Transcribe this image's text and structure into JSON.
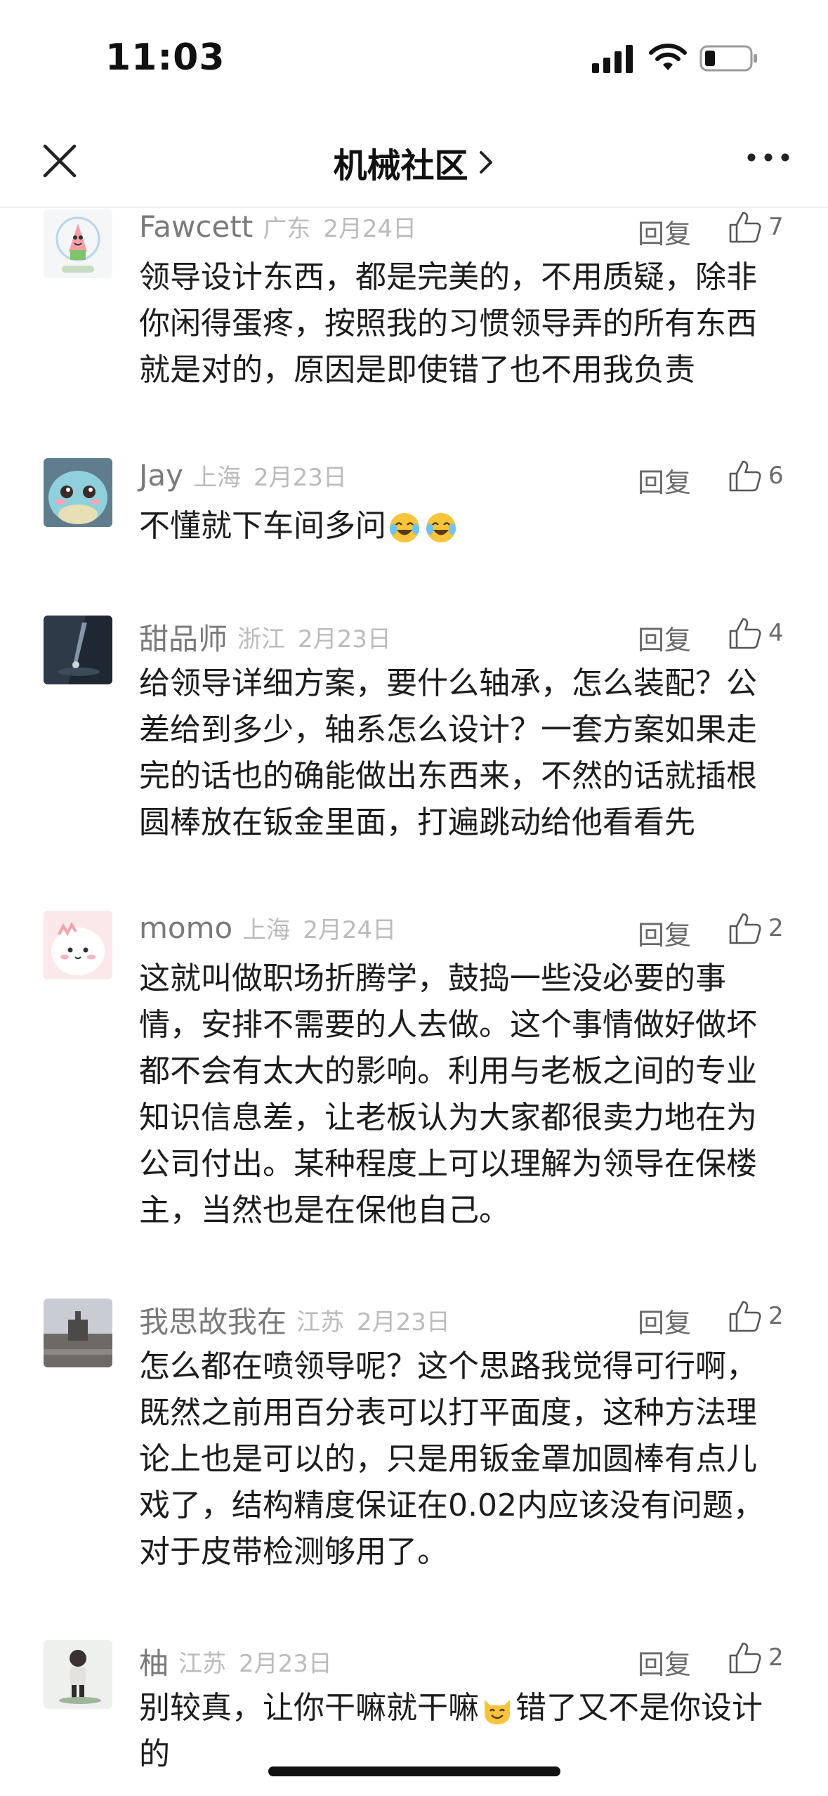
{
  "status_bar": {
    "time": "11:03"
  },
  "nav": {
    "title": "机械社区"
  },
  "reply_label": "回复",
  "comments": [
    {
      "username": "Fawcett",
      "location": "广东",
      "date": "2月24日",
      "likes": "7",
      "parts": [
        "领导设计东西，都是完美的，不用质疑，除非你闲得蛋疼，按照我的习惯领导弄的所有东西就是对的，原因是即使错了也不用我负责"
      ]
    },
    {
      "username": "Jay",
      "location": "上海",
      "date": "2月23日",
      "likes": "6",
      "parts": [
        "不懂就下车间多问"
      ]
    },
    {
      "username": "甜品师",
      "location": "浙江",
      "date": "2月23日",
      "likes": "4",
      "parts": [
        "给领导详细方案，要什么轴承，怎么装配？公差给到多少，轴系怎么设计？一套方案如果走完的话也的确能做出东西来，不然的话就插根圆棒放在钣金里面，打遍跳动给他看看先"
      ]
    },
    {
      "username": "momo",
      "location": "上海",
      "date": "2月24日",
      "likes": "2",
      "parts": [
        "这就叫做职场折腾学，鼓捣一些没必要的事情，安排不需要的人去做。这个事情做好做坏都不会有太大的影响。利用与老板之间的专业知识信息差，让老板认为大家都很卖力地在为公司付出。某种程度上可以理解为领导在保楼主，当然也是在保他自己。"
      ]
    },
    {
      "username": "我思故我在",
      "location": "江苏",
      "date": "2月23日",
      "likes": "2",
      "parts": [
        "怎么都在喷领导呢？这个思路我觉得可行啊，既然之前用百分表可以打平面度，这种方法理论上也是可以的，只是用钣金罩加圆棒有点儿戏了，结构精度保证在0.02内应该没有问题，对于皮带检测够用了。"
      ]
    },
    {
      "username": "柚",
      "location": "江苏",
      "date": "2月23日",
      "likes": "2",
      "parts": [
        "别较真，让你干嘛就干嘛",
        "错了又不是你设计的"
      ]
    }
  ]
}
